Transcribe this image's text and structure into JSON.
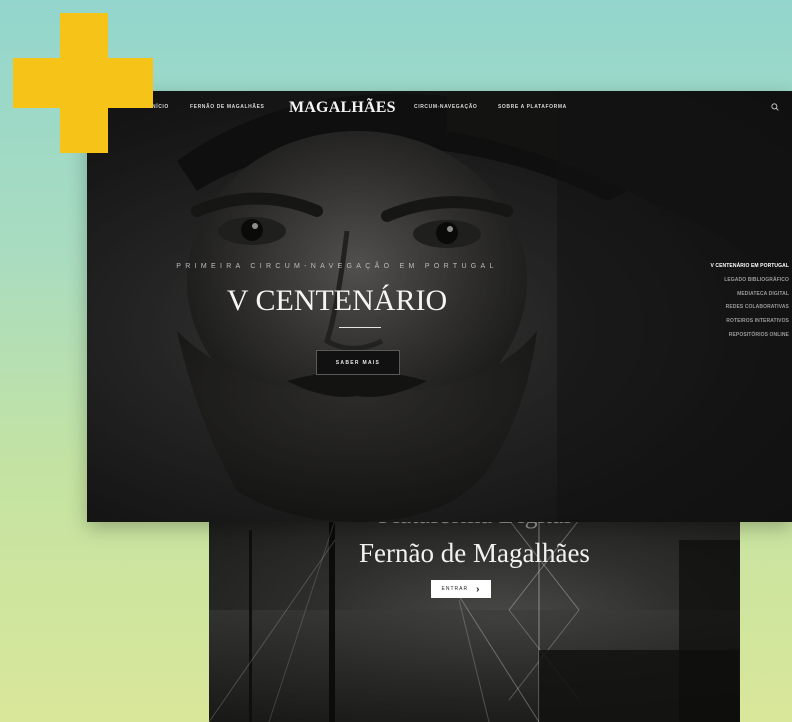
{
  "nav": {
    "items_left": [
      "INÍCIO",
      "FERNÃO DE MAGALHÃES"
    ],
    "brand": "MAGALHÃES",
    "items_right": [
      "CIRCUM-NAVEGAÇÃO",
      "SOBRE A PLATAFORMA"
    ],
    "search_icon": "search-icon"
  },
  "hero": {
    "kicker": "PRIMEIRA CIRCUM-NAVEGAÇÃO EM PORTUGAL",
    "title": "V CENTENÁRIO",
    "button_label": "SABER MAIS"
  },
  "side_menu": {
    "items": [
      "V CENTENÁRIO EM PORTUGAL",
      "LEGADO BIBLIOGRÁFICO",
      "MEDIATECA DIGITAL",
      "REDES COLABORATIVAS",
      "ROTEIROS INTERATIVOS",
      "REPOSITÓRIOS ONLINE"
    ],
    "active_index": 0
  },
  "second_screen": {
    "title_line1": "Plataforma Digital",
    "title_line2": "Fernão de Magalhães",
    "button_label": "ENTRAR",
    "button_icon": "chevron-right-icon"
  },
  "colors": {
    "accent_yellow": "#f6c418",
    "background_top": "#93d6cd",
    "background_bottom": "#d9e79a"
  }
}
